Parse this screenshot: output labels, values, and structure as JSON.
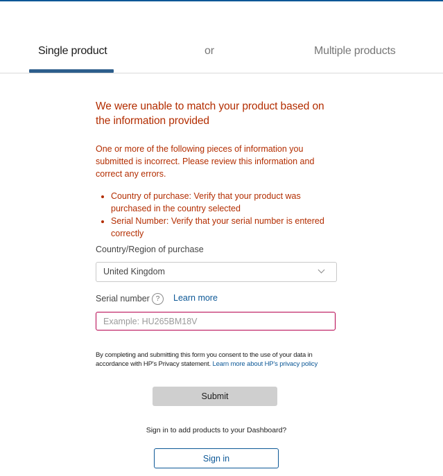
{
  "tabs": {
    "single": "Single product",
    "or": "or",
    "multiple": "Multiple products"
  },
  "error": {
    "title": "We were unable to match your product based on the information provided",
    "body": "One or more of the following pieces of information you submitted is incorrect. Please review this information and correct any errors.",
    "items": [
      "Country of purchase: Verify that your product was purchased in the country selected",
      "Serial Number: Verify that your serial number is entered correctly"
    ]
  },
  "country": {
    "label": "Country/Region of purchase",
    "selected": "United Kingdom"
  },
  "serial": {
    "label": "Serial number",
    "help_glyph": "?",
    "learn_more": "Learn more",
    "value": "",
    "placeholder": "Example: HU265BM18V"
  },
  "consent": {
    "text": "By completing and submitting this form you consent to the use of your data in accordance with HP's Privacy statement.",
    "link": "Learn more about HP's privacy policy"
  },
  "submit_label": "Submit",
  "signin": {
    "prompt": "Sign in to add products to your Dashboard?",
    "button": "Sign in"
  },
  "colors": {
    "accent": "#0b5796",
    "error": "#b32d00",
    "input_error_border": "#b5004d"
  }
}
